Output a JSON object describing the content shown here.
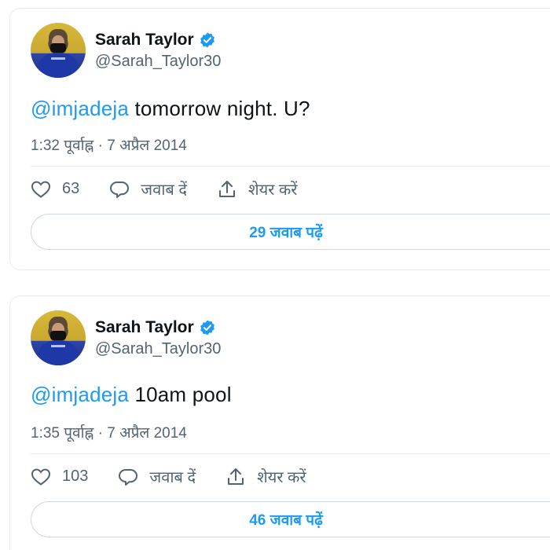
{
  "tweets": [
    {
      "display_name": "Sarah Taylor",
      "handle": "@Sarah_Taylor30",
      "mention": "@imjadeja",
      "text": " tomorrow night. U?",
      "timestamp": "1:32 पूर्वाह्न · 7 अप्रैल 2014",
      "likes": "63",
      "reply_label": "जवाब दें",
      "share_label": "शेयर करें",
      "read_replies": "29 जवाब पढ़ें"
    },
    {
      "display_name": "Sarah Taylor",
      "handle": "@Sarah_Taylor30",
      "mention": "@imjadeja",
      "text": " 10am pool",
      "timestamp": "1:35 पूर्वाह्न · 7 अप्रैल 2014",
      "likes": "103",
      "reply_label": "जवाब दें",
      "share_label": "शेयर करें",
      "read_replies": "46 जवाब पढ़ें"
    }
  ],
  "icons": {
    "like": "heart-icon",
    "reply": "speech-bubble-icon",
    "share": "share-upload-icon",
    "verified": "verified-badge-icon"
  },
  "colors": {
    "accent": "#1d9bf0",
    "text": "#0f1419",
    "muted": "#536471",
    "border": "#e6ecf0"
  }
}
